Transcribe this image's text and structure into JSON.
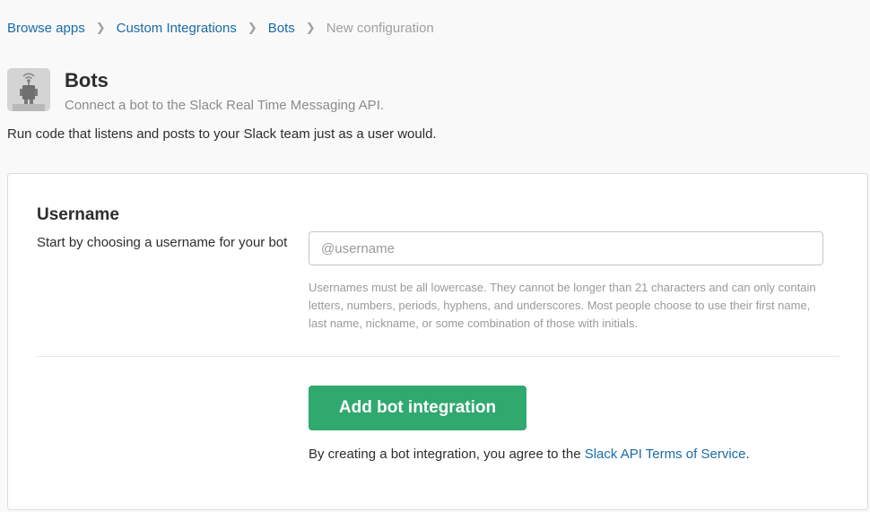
{
  "breadcrumb": {
    "items": [
      "Browse apps",
      "Custom Integrations",
      "Bots"
    ],
    "current": "New configuration"
  },
  "app": {
    "icon": "bot-icon",
    "title": "Bots",
    "subtitle": "Connect a bot to the Slack Real Time Messaging API.",
    "description": "Run code that listens and posts to your Slack team just as a user would."
  },
  "form": {
    "section_title": "Username",
    "section_description": "Start by choosing a username for your bot",
    "username_placeholder": "@username",
    "username_value": "",
    "help_text": "Usernames must be all lowercase. They cannot be longer than 21 characters and can only contain letters, numbers, periods, hyphens, and underscores. Most people choose to use their first name, last name, nickname, or some combination of those with initials.",
    "submit_label": "Add bot integration",
    "terms_prefix": "By creating a bot integration, you agree to the ",
    "terms_link": "Slack API Terms of Service",
    "terms_suffix": "."
  },
  "colors": {
    "link": "#1a6aa8",
    "button": "#2fa96e",
    "muted": "#9a9a9c"
  }
}
